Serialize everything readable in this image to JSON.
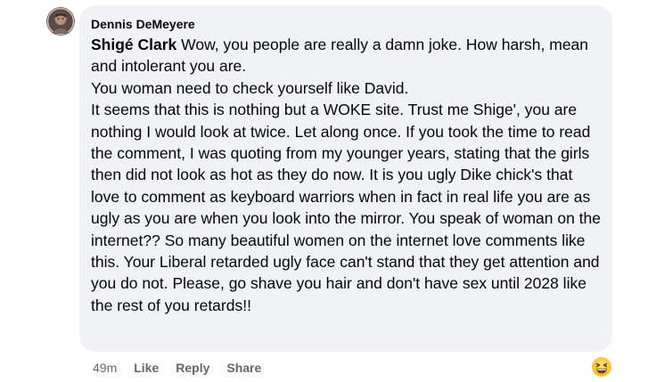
{
  "comment": {
    "author": "Dennis DeMeyere",
    "mention": "Shigé Clark",
    "lines": [
      " Wow, you people are really a damn joke. How harsh, mean and intolerant you are.",
      "You woman need to check yourself like David.",
      "It seems that this is nothing but a WOKE site. Trust me Shige', you are nothing I would look at twice. Let along once. If you took the time to read the comment, I was quoting from my younger years, stating that the girls then did not look as hot as they do now. It is you ugly Dike chick's that love to comment as keyboard warriors when in fact in real life you are as ugly as you are when you look into the mirror. You speak of woman on the internet?? So many beautiful women on the internet love comments like this. Your Liberal retarded ugly face can't stand that they get attention and you do not. Please, go shave you hair and don't have sex until 2028 like the rest of you retards!!"
    ]
  },
  "actions": {
    "time": "49m",
    "like": "Like",
    "reply": "Reply",
    "share": "Share"
  },
  "icons": {
    "avatar": "profile-photo",
    "reaction": "grinning-squinting-face-emoji"
  },
  "colors": {
    "bubble": "#f0f2f5",
    "text": "#050505",
    "secondary": "#65676b"
  }
}
